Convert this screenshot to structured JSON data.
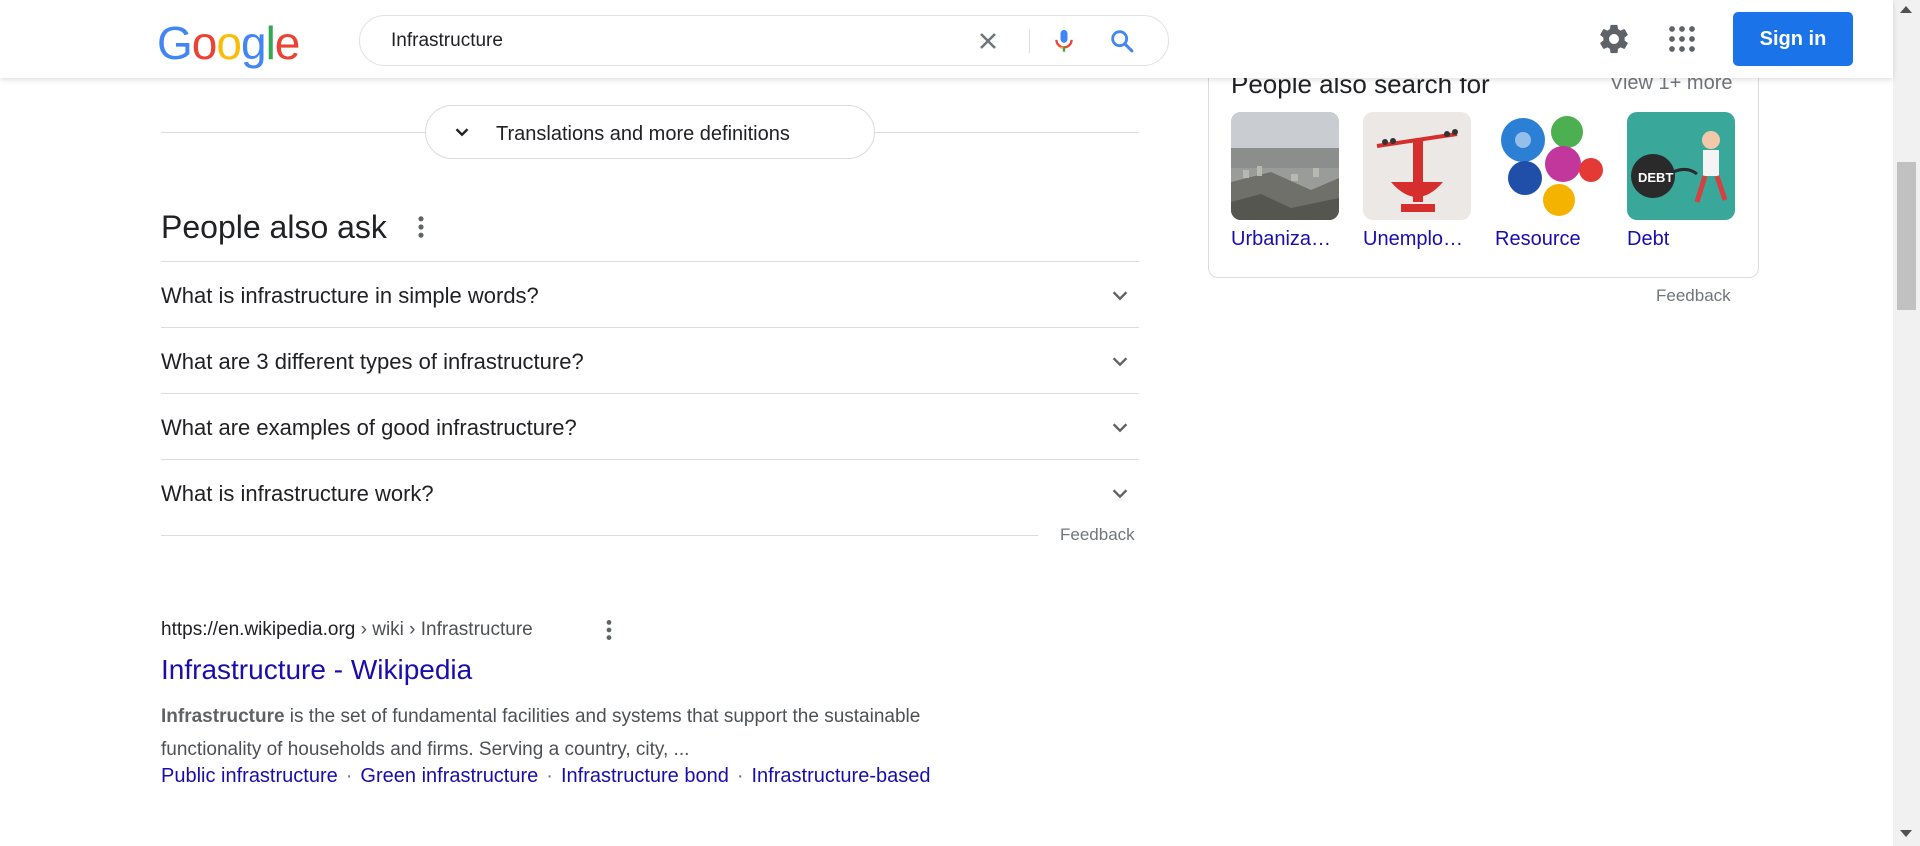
{
  "header": {
    "logo_letters": [
      "G",
      "o",
      "o",
      "g",
      "l",
      "e"
    ],
    "logo_colors": [
      "#4285f4",
      "#ea4335",
      "#fbbc05",
      "#4285f4",
      "#34a853",
      "#ea4335"
    ],
    "search_query": "Infrastructure",
    "signin_label": "Sign in",
    "icons": [
      "clear-icon",
      "microphone-icon",
      "search-icon",
      "settings-gear-icon",
      "apps-grid-icon"
    ],
    "accent_color": "#1a73e8"
  },
  "translations": {
    "label": "Translations and more definitions",
    "icon": "chevron-down-icon"
  },
  "people_also_ask": {
    "title": "People also ask",
    "questions": [
      "What is infrastructure in simple words?",
      "What are 3 different types of infrastructure?",
      "What are examples of good infrastructure?",
      "What is infrastructure work?"
    ],
    "feedback": "Feedback"
  },
  "result": {
    "url_host": "https://en.wikipedia.org",
    "url_crumbs": " › wiki › Infrastructure",
    "title": "Infrastructure - Wikipedia",
    "snippet_bold": "Infrastructure",
    "snippet_rest": " is the set of fundamental facilities and systems that support the sustainable functionality of households and firms. Serving a country, city, ...",
    "sitelinks": [
      "Public infrastructure",
      "Green infrastructure",
      "Infrastructure bond",
      "Infrastructure-based"
    ],
    "link_color": "#1a0dab"
  },
  "side_panel": {
    "title": "People also search for",
    "view_more": "View 1+ more",
    "items": [
      {
        "label": "Urbaniza…"
      },
      {
        "label": "Unemplo…"
      },
      {
        "label": "Resource"
      },
      {
        "label": "Debt"
      }
    ],
    "feedback": "Feedback"
  }
}
